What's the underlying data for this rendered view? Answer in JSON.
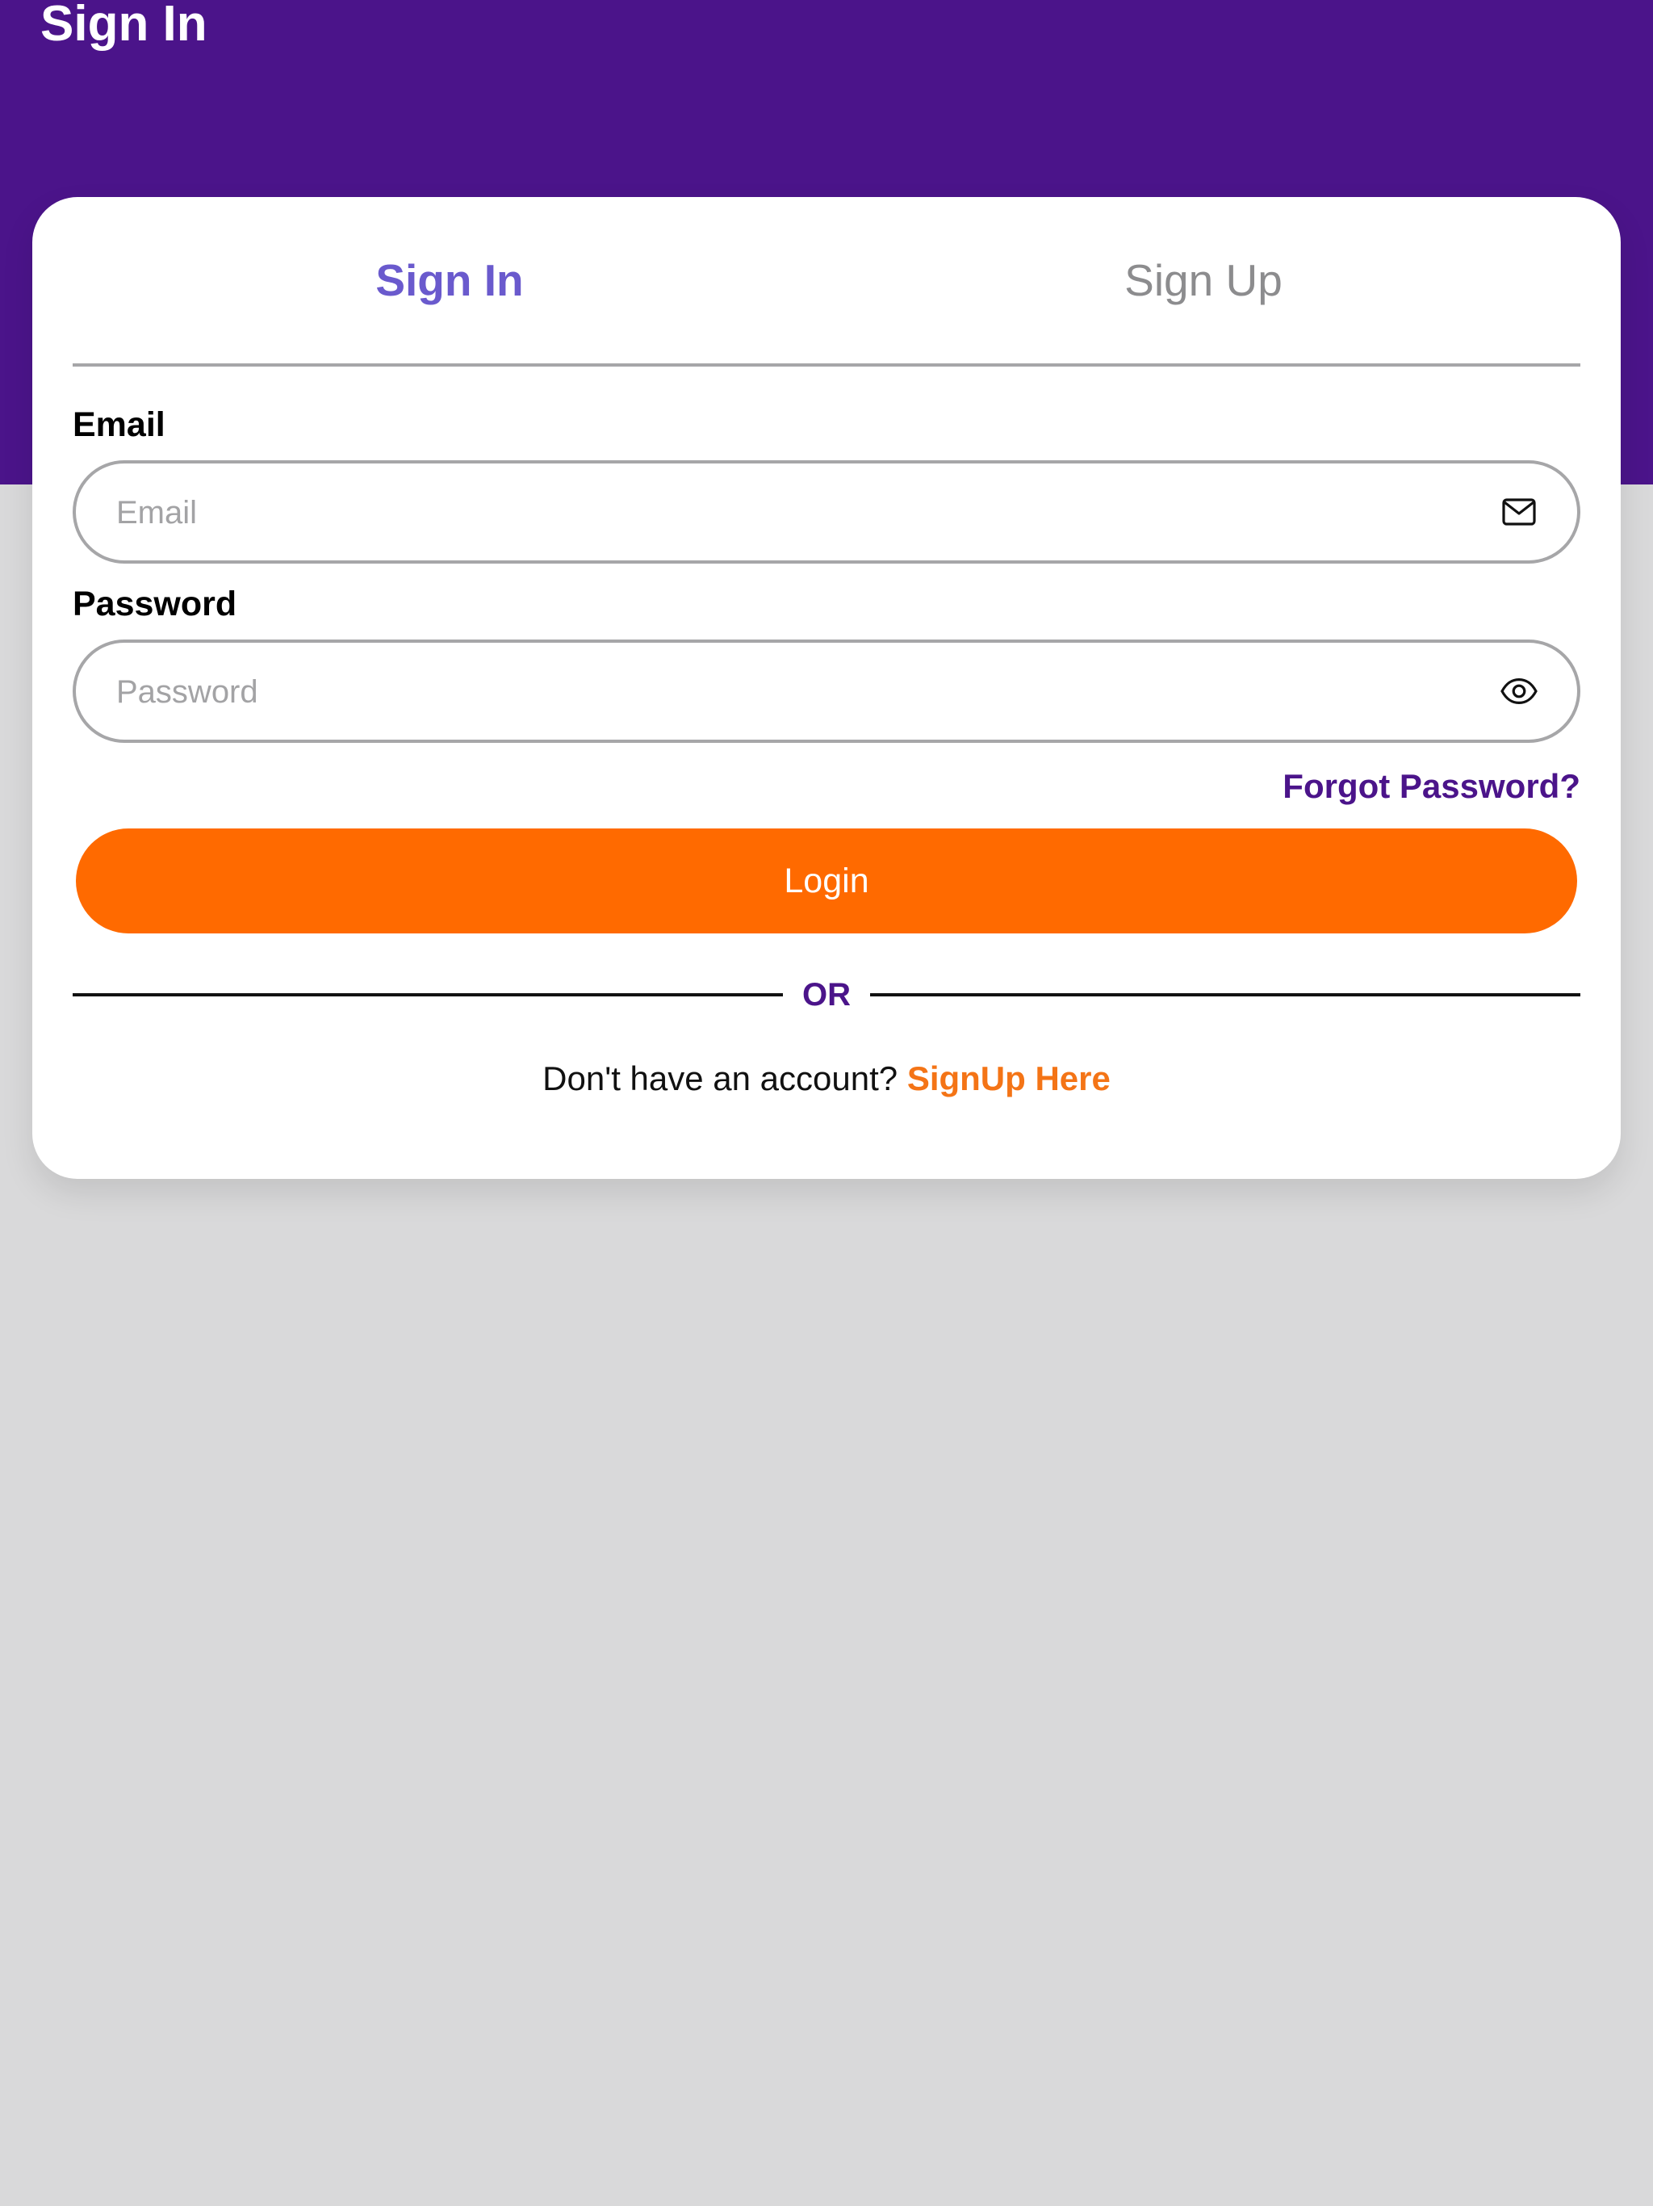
{
  "colors": {
    "header_purple": "#4b148a",
    "active_tab": "#6a5acd",
    "accent_orange": "#ff6a00",
    "link_purple": "#4b148a",
    "link_orange": "#f47416",
    "background_gray": "#d9d9da"
  },
  "header": {
    "title": "Sign In"
  },
  "tabs": [
    {
      "label": "Sign In",
      "active": true
    },
    {
      "label": "Sign Up",
      "active": false
    }
  ],
  "form": {
    "email": {
      "label": "Email",
      "placeholder": "Email",
      "value": "",
      "icon": "mail-icon"
    },
    "password": {
      "label": "Password",
      "placeholder": "Password",
      "value": "",
      "icon": "eye-icon"
    },
    "forgot_label": "Forgot Password?",
    "login_label": "Login",
    "or_label": "OR",
    "signup_prompt": "Don't have an account?",
    "signup_link": "SignUp Here"
  }
}
